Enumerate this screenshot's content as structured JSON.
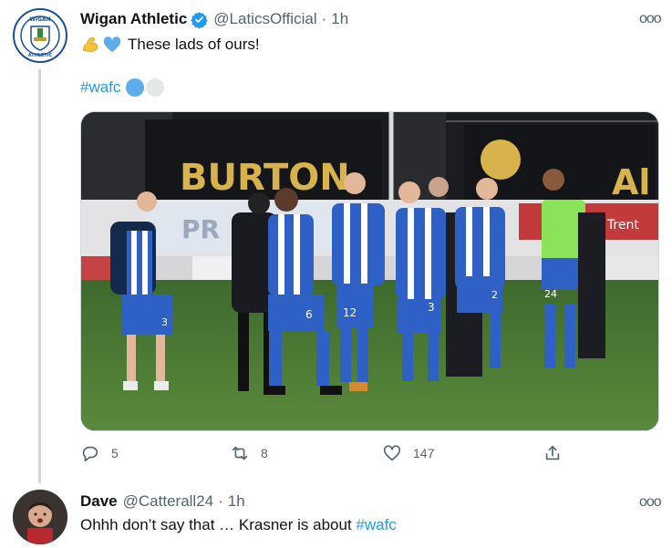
{
  "tweet": {
    "author_name": "Wigan Athletic",
    "handle": "@LaticsOfficial",
    "separator": "·",
    "time": "1h",
    "more": "ooo",
    "text": "These lads of ours!",
    "hashtag": "#wafc",
    "media_banner": {
      "board_left": "BURTON",
      "board_right": "Al",
      "board_lower": "PR",
      "board_lower_right": "on Trent"
    },
    "player_numbers": [
      "3",
      "6",
      "12",
      "3",
      "2",
      "24"
    ]
  },
  "actions": {
    "replies": "5",
    "retweets": "8",
    "likes": "147"
  },
  "reply": {
    "author_name": "Dave",
    "handle": "@Catterall24",
    "separator": "·",
    "time": "1h",
    "more": "ooo",
    "text_prefix": "Ohhh don’t say that … Krasner is about ",
    "hashtag": "#wafc"
  },
  "colors": {
    "link": "#1d9bf0",
    "secondary_text": "#536471",
    "club_blue": "#1b4f9c",
    "thread_line": "#cfd9de"
  }
}
